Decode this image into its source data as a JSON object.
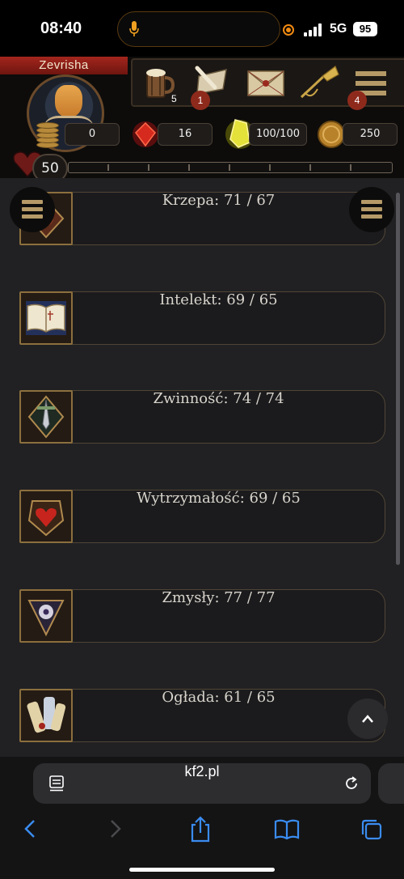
{
  "status_bar": {
    "time": "08:40",
    "network": "5G",
    "battery": "95"
  },
  "character": {
    "name": "Zevrisha",
    "level": "50"
  },
  "icon_bar": [
    {
      "name": "tavern",
      "count": "5"
    },
    {
      "name": "quests",
      "badge": "1"
    },
    {
      "name": "mail"
    },
    {
      "name": "horn"
    },
    {
      "name": "menu",
      "badge": "4"
    }
  ],
  "resources": {
    "coins": "0",
    "crystals": "16",
    "energy": "100/100",
    "gold": "250"
  },
  "stats": [
    {
      "label": "Krzepa: 71 / 67",
      "icon": "fist-emblem-icon"
    },
    {
      "label": "Intelekt: 69 / 65",
      "icon": "open-book-icon"
    },
    {
      "label": "Zwinność: 74 / 74",
      "icon": "dagger-icon"
    },
    {
      "label": "Wytrzymałość: 69 / 65",
      "icon": "heart-shield-icon"
    },
    {
      "label": "Zmysły: 77 / 77",
      "icon": "eye-emblem-icon"
    },
    {
      "label": "Ogłada: 61 / 65",
      "icon": "scrolls-icon"
    }
  ],
  "browser": {
    "url": "kf2.pl"
  },
  "colors": {
    "accent_gold": "#b59a68",
    "ribbon_red": "#a3261d",
    "badge_red": "#8e2a1c",
    "browser_blue": "#3a8cf0"
  }
}
